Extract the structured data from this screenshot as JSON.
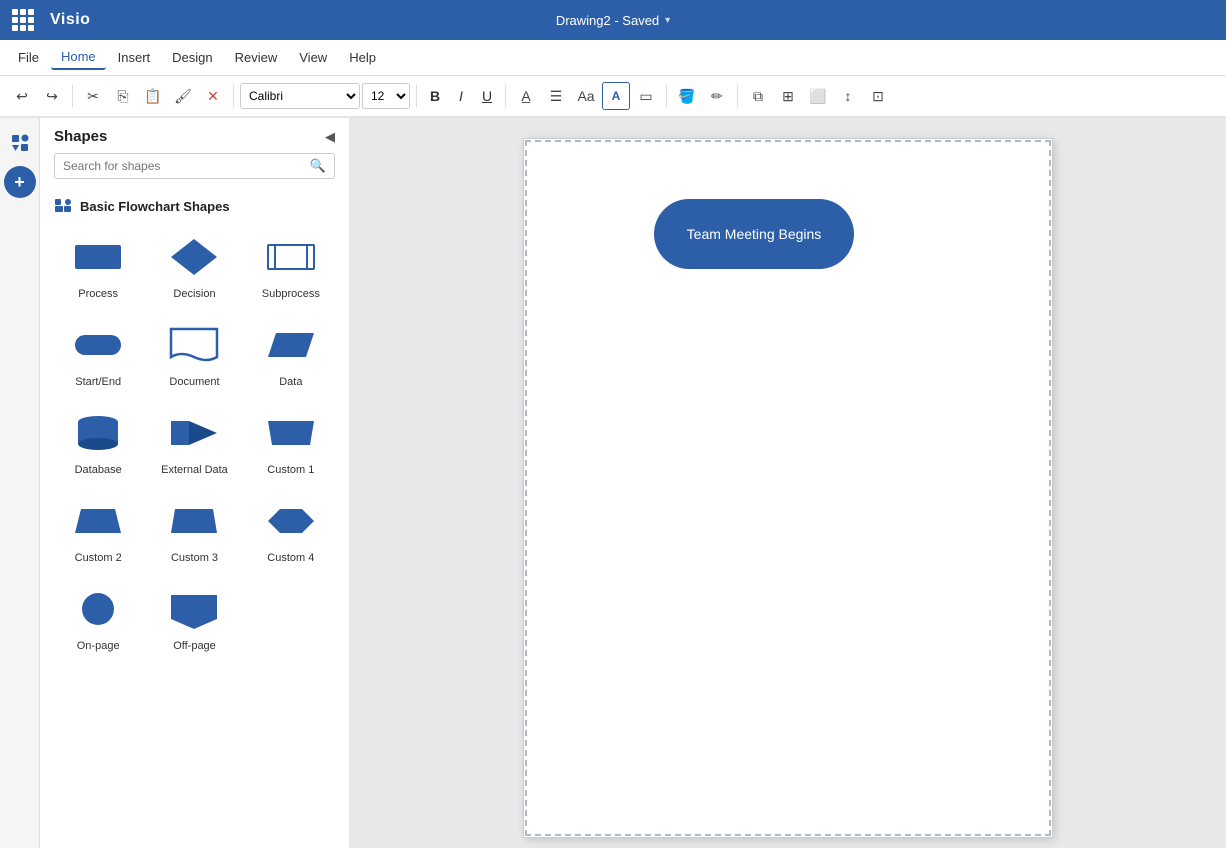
{
  "titleBar": {
    "appName": "Visio",
    "docTitle": "Drawing2  -  Saved",
    "chevron": "▾"
  },
  "menuBar": {
    "items": [
      {
        "label": "File",
        "active": false
      },
      {
        "label": "Home",
        "active": true
      },
      {
        "label": "Insert",
        "active": false
      },
      {
        "label": "Design",
        "active": false
      },
      {
        "label": "Review",
        "active": false
      },
      {
        "label": "View",
        "active": false
      },
      {
        "label": "Help",
        "active": false
      }
    ]
  },
  "toolbar": {
    "fontName": "Calibri",
    "fontSize": "12",
    "bold": "B",
    "italic": "I",
    "underline": "U"
  },
  "shapesPanel": {
    "title": "Shapes",
    "searchPlaceholder": "Search for shapes",
    "categoryName": "Basic Flowchart Shapes",
    "shapes": [
      {
        "name": "Process",
        "type": "rect"
      },
      {
        "name": "Decision",
        "type": "diamond"
      },
      {
        "name": "Subprocess",
        "type": "subprocess"
      },
      {
        "name": "Start/End",
        "type": "stadium"
      },
      {
        "name": "Document",
        "type": "document"
      },
      {
        "name": "Data",
        "type": "parallelogram"
      },
      {
        "name": "Database",
        "type": "database"
      },
      {
        "name": "External Data",
        "type": "externaldata"
      },
      {
        "name": "Custom 1",
        "type": "custom1"
      },
      {
        "name": "Custom 2",
        "type": "custom2"
      },
      {
        "name": "Custom 3",
        "type": "custom3"
      },
      {
        "name": "Custom 4",
        "type": "custom4"
      },
      {
        "name": "On-page",
        "type": "circle"
      },
      {
        "name": "Off-page",
        "type": "offpage"
      }
    ]
  },
  "canvas": {
    "shapes": [
      {
        "id": "shape1",
        "label": "Team Meeting Begins",
        "type": "stadium"
      }
    ]
  },
  "colors": {
    "primary": "#2d5fa8",
    "titleBg": "#2d5fa8"
  }
}
